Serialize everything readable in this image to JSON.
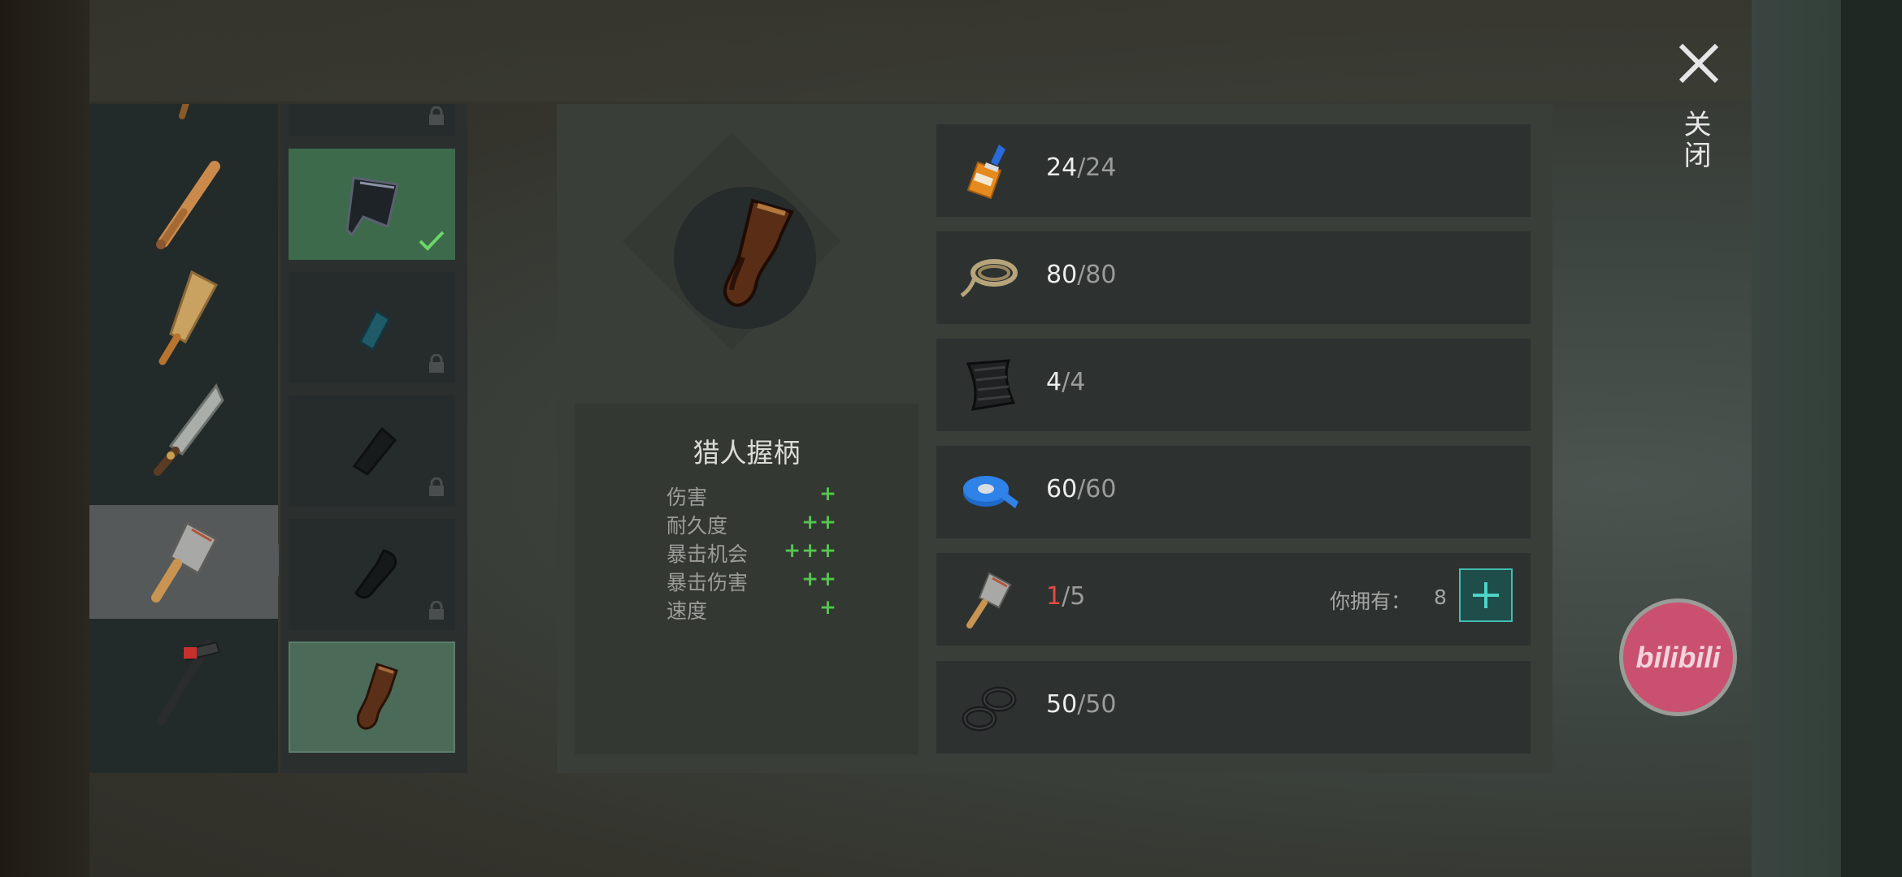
{
  "weapons": [
    {
      "icon": "weapon-partial-icon"
    },
    {
      "icon": "baseball-bat-icon"
    },
    {
      "icon": "wooden-paddle-icon"
    },
    {
      "icon": "machete-icon"
    },
    {
      "icon": "cleaver-icon",
      "selected": true
    },
    {
      "icon": "hammer-icon"
    },
    {
      "icon": "weapon-partial-bottom-icon"
    }
  ],
  "variants": [
    {
      "icon": "handle-partial-icon",
      "state": "locked"
    },
    {
      "icon": "cleaver-blade-icon",
      "state": "equipped"
    },
    {
      "icon": "blue-grip-icon",
      "state": "locked"
    },
    {
      "icon": "black-grip-icon",
      "state": "locked"
    },
    {
      "icon": "black-pistol-grip-icon",
      "state": "locked"
    },
    {
      "icon": "hunter-grip-icon",
      "state": "current"
    }
  ],
  "item": {
    "name": "猎人握柄",
    "stats": [
      {
        "label": "伤害",
        "value": "+"
      },
      {
        "label": "耐久度",
        "value": "++"
      },
      {
        "label": "暴击机会",
        "value": "+++"
      },
      {
        "label": "暴击伤害",
        "value": "++"
      },
      {
        "label": "速度",
        "value": "+"
      }
    ]
  },
  "resources": [
    {
      "icon": "glue-icon",
      "have": "24",
      "slash": "/",
      "need": "24"
    },
    {
      "icon": "rope-icon",
      "have": "80",
      "slash": "/",
      "need": "80"
    },
    {
      "icon": "carbon-fabric-icon",
      "have": "4",
      "slash": "/",
      "need": "4"
    },
    {
      "icon": "duct-tape-icon",
      "have": "60",
      "slash": "/",
      "need": "60"
    },
    {
      "icon": "cleaver-icon",
      "have": "1",
      "slash": "/",
      "need": "5",
      "own_label": "你拥有：",
      "own_value": "8"
    },
    {
      "icon": "rubber-rings-icon",
      "have": "50",
      "slash": "/",
      "need": "50"
    }
  ],
  "close": {
    "label": "关闭"
  },
  "watermark": {
    "text": "bilibili"
  },
  "colors": {
    "accent_green": "#55c54f",
    "insufficient_red": "#e34a44",
    "add_button_border": "#44bcb2"
  }
}
